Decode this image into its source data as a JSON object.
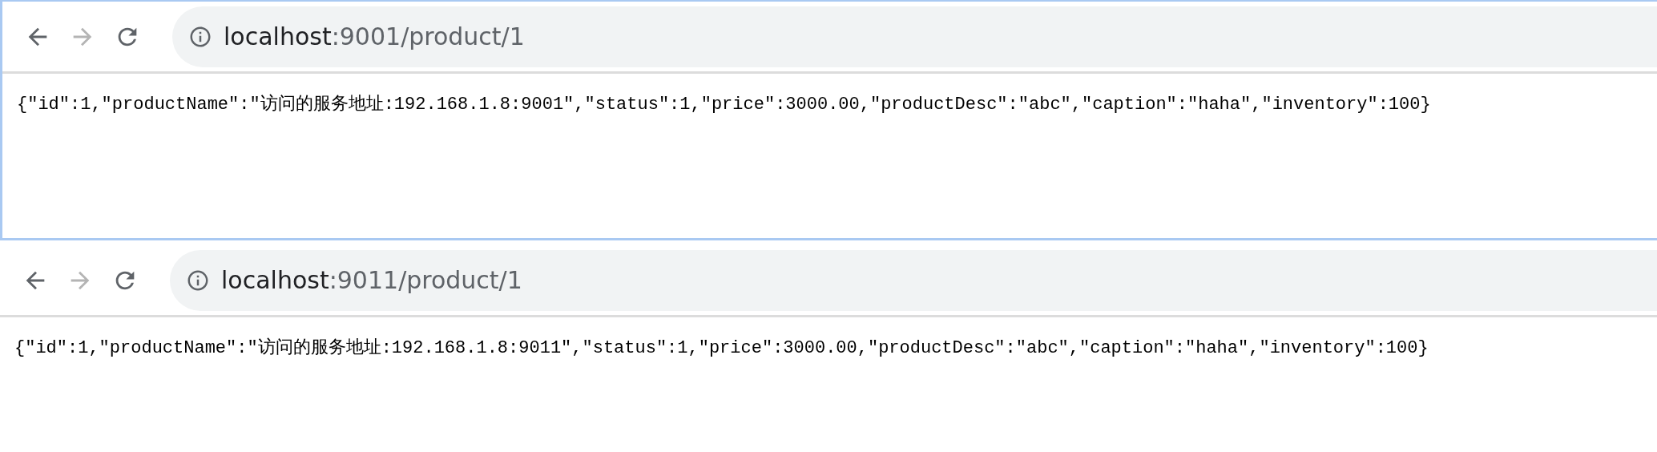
{
  "windows": [
    {
      "focused": true,
      "back": {
        "disabled": false
      },
      "forward": {
        "disabled": true
      },
      "address": {
        "host": "localhost",
        "path": ":9001/product/1"
      },
      "body": "{\"id\":1,\"productName\":\"访问的服务地址:192.168.1.8:9001\",\"status\":1,\"price\":3000.00,\"productDesc\":\"abc\",\"caption\":\"haha\",\"inventory\":100}"
    },
    {
      "focused": false,
      "back": {
        "disabled": false
      },
      "forward": {
        "disabled": true
      },
      "address": {
        "host": "localhost",
        "path": ":9011/product/1"
      },
      "body": "{\"id\":1,\"productName\":\"访问的服务地址:192.168.1.8:9011\",\"status\":1,\"price\":3000.00,\"productDesc\":\"abc\",\"caption\":\"haha\",\"inventory\":100}"
    }
  ]
}
